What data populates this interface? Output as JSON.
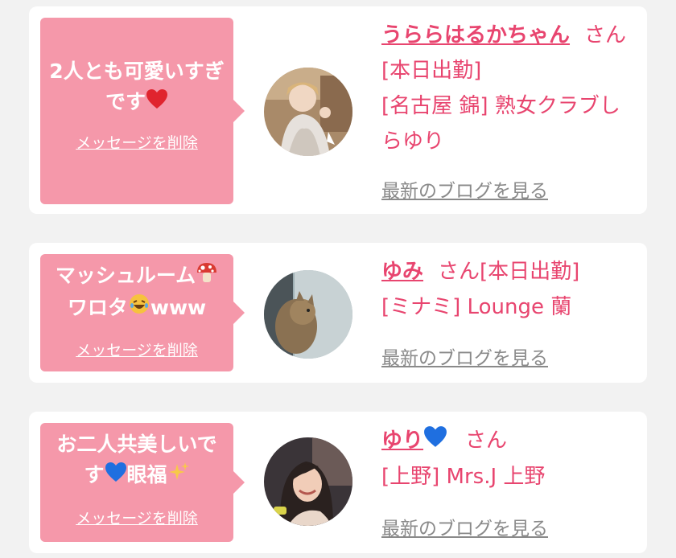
{
  "cards": [
    {
      "message": "2人とも可愛いすぎです",
      "message_emoji": "heart-red",
      "delete_label": "メッセージを削除",
      "name": "うららはるかちゃん",
      "suffix": "さん[本日出勤]",
      "shop": "[名古屋 錦] 熟女クラブしらゆり",
      "blog_label": "最新のブログを見る"
    },
    {
      "message_line1": "マッシュルーム",
      "message_line2a": "ワロタ",
      "message_line2b": "www",
      "delete_label": "メッセージを削除",
      "name": "ゆみ",
      "suffix": "さん[本日出勤]",
      "shop": "[ミナミ] Lounge 蘭",
      "blog_label": "最新のブログを見る"
    },
    {
      "message_line1": "お二人共美しいで",
      "message_line2a": "す",
      "message_line2b": "眼福",
      "delete_label": "メッセージを削除",
      "name": "ゆり",
      "suffix": "さん",
      "shop": "[上野] Mrs.J 上野",
      "blog_label": "最新のブログを見る"
    }
  ],
  "colors": {
    "bubble": "#f598aa",
    "accent": "#e8456f",
    "link_gray": "#8a8a8a",
    "background": "#f2f2f2"
  },
  "icons": [
    "heart-icon",
    "mushroom-icon",
    "laughing-emoji-icon",
    "blue-heart-icon",
    "sparkles-icon"
  ]
}
